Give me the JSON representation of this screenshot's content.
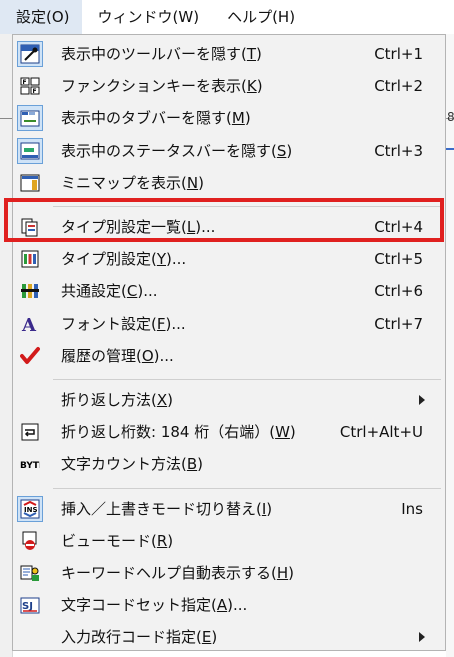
{
  "menubar": [
    {
      "label": "設定(O)",
      "name": "menubar-settings",
      "active": true
    },
    {
      "label": "ウィンドウ(W)",
      "name": "menubar-window",
      "active": false
    },
    {
      "label": "ヘルプ(H)",
      "name": "menubar-help",
      "active": false
    }
  ],
  "background": {
    "tab_number": "8"
  },
  "menu": {
    "items": [
      {
        "type": "item",
        "name": "menu-item-hide-toolbar",
        "icon": "toolbar-icon",
        "pre": "表示中のツールバーを隠す(",
        "key": "T",
        "post": ")",
        "shortcut": "Ctrl+1",
        "checked": true
      },
      {
        "type": "item",
        "name": "menu-item-show-function-keys",
        "icon": "function-keys-icon",
        "pre": "ファンクションキーを表示(",
        "key": "K",
        "post": ")",
        "shortcut": "Ctrl+2",
        "checked": false
      },
      {
        "type": "item",
        "name": "menu-item-hide-tabbar",
        "icon": "tabbar-icon",
        "pre": "表示中のタブバーを隠す(",
        "key": "M",
        "post": ")",
        "shortcut": "",
        "checked": true
      },
      {
        "type": "item",
        "name": "menu-item-hide-statusbar",
        "icon": "statusbar-icon",
        "pre": "表示中のステータスバーを隠す(",
        "key": "S",
        "post": ")",
        "shortcut": "Ctrl+3",
        "checked": true
      },
      {
        "type": "item",
        "name": "menu-item-show-minimap",
        "icon": "minimap-icon",
        "pre": "ミニマップを表示(",
        "key": "N",
        "post": ")",
        "shortcut": "",
        "checked": false
      },
      {
        "type": "sep"
      },
      {
        "type": "item",
        "name": "menu-item-type-settings-list",
        "icon": "type-settings-list-icon",
        "pre": "タイプ別設定一覧(",
        "key": "L",
        "post": ")...",
        "shortcut": "Ctrl+4",
        "checked": false
      },
      {
        "type": "item",
        "name": "menu-item-type-settings",
        "icon": "type-settings-icon",
        "pre": "タイプ別設定(",
        "key": "Y",
        "post": ")...",
        "shortcut": "Ctrl+5",
        "checked": false
      },
      {
        "type": "item",
        "name": "menu-item-common-settings",
        "icon": "common-settings-icon",
        "pre": "共通設定(",
        "key": "C",
        "post": ")...",
        "shortcut": "Ctrl+6",
        "checked": false
      },
      {
        "type": "item",
        "name": "menu-item-font-settings",
        "icon": "font-icon",
        "pre": "フォント設定(",
        "key": "F",
        "post": ")...",
        "shortcut": "Ctrl+7",
        "checked": false
      },
      {
        "type": "item",
        "name": "menu-item-history",
        "icon": "checkmark-icon",
        "pre": "履歴の管理(",
        "key": "O",
        "post": ")...",
        "shortcut": "",
        "checked": false
      },
      {
        "type": "sep"
      },
      {
        "type": "item",
        "name": "menu-item-wrap-method",
        "icon": "",
        "pre": "折り返し方法(",
        "key": "X",
        "post": ")",
        "shortcut": "",
        "submenu": true,
        "checked": false
      },
      {
        "type": "item",
        "name": "menu-item-wrap-columns",
        "icon": "wrap-icon",
        "pre": "折り返し桁数: 184 桁（右端）(",
        "key": "W",
        "post": ")",
        "shortcut": "Ctrl+Alt+U",
        "checked": false
      },
      {
        "type": "item",
        "name": "menu-item-char-count-method",
        "icon": "byte-icon",
        "pre": "文字カウント方法(",
        "key": "B",
        "post": ")",
        "shortcut": "",
        "checked": false
      },
      {
        "type": "sep"
      },
      {
        "type": "item",
        "name": "menu-item-insert-overwrite",
        "icon": "insert-mode-icon",
        "pre": "挿入／上書きモード切り替え(",
        "key": "I",
        "post": ")",
        "shortcut": "Ins",
        "checked": true
      },
      {
        "type": "item",
        "name": "menu-item-view-mode",
        "icon": "view-mode-icon",
        "pre": "ビューモード(",
        "key": "R",
        "post": ")",
        "shortcut": "",
        "checked": false
      },
      {
        "type": "item",
        "name": "menu-item-keyword-help",
        "icon": "keyword-help-icon",
        "pre": "キーワードヘルプ自動表示する(",
        "key": "H",
        "post": ")",
        "shortcut": "",
        "checked": false
      },
      {
        "type": "item",
        "name": "menu-item-charset",
        "icon": "charset-icon",
        "pre": "文字コードセット指定(",
        "key": "A",
        "post": ")...",
        "shortcut": "",
        "checked": false
      },
      {
        "type": "item",
        "name": "menu-item-newline-code",
        "icon": "",
        "pre": "入力改行コード指定(",
        "key": "E",
        "post": ")",
        "shortcut": "",
        "submenu": true,
        "checked": false
      }
    ]
  },
  "colors": {
    "highlight": "#e0201f",
    "menu_bg": "#f2f2f2",
    "checked_bg": "#cfe3f7"
  }
}
